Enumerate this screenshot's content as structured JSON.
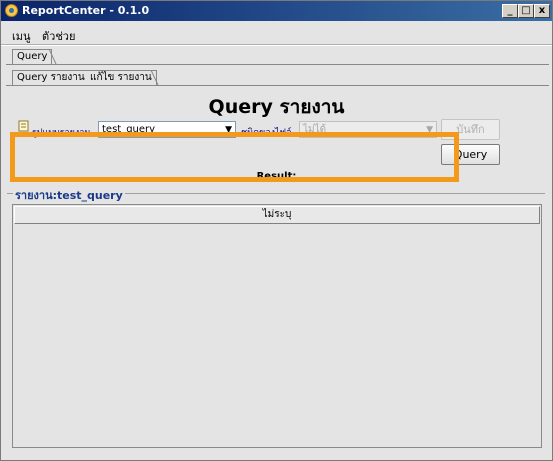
{
  "window": {
    "title": "ReportCenter - 0.1.0",
    "controls": [
      "_",
      "□",
      "x"
    ]
  },
  "menu": {
    "items": [
      "เมนู",
      "ตัวช่วย"
    ]
  },
  "tabs_outer": [
    "Query"
  ],
  "tabs_inner": [
    "Query รายงาน",
    "แก้ไข รายงาน"
  ],
  "heading": "Query รายงาน",
  "form": {
    "report_type_label": "รูปแบบรายงาน",
    "report_type_value": "test_query",
    "save_type_label": "ชนิดของไฟล์",
    "save_type_value": "ไม่ได้",
    "save_button": "บันทึก",
    "query_button": "Query"
  },
  "result_label": "Result:",
  "group_title": "รายงาน:test_query",
  "table": {
    "columns": [
      "ไม่ระบุ"
    ]
  },
  "colors": {
    "highlight": "#f39a1c",
    "titlebar_start": "#0a246a",
    "titlebar_end": "#3a6ea5"
  }
}
